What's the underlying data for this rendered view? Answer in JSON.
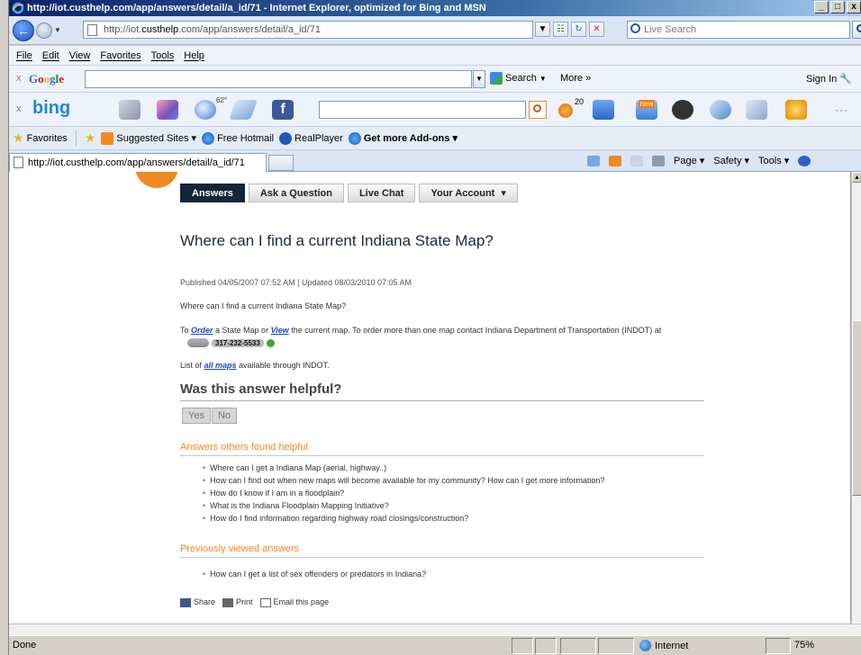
{
  "window": {
    "title": "http://iot.custhelp.com/app/answers/detail/a_id/71 - Internet Explorer, optimized for Bing and MSN",
    "buttons": [
      "_",
      "□",
      "x"
    ]
  },
  "address": {
    "url_prefix": "http://iot.",
    "url_host": "custhelp",
    "url_suffix": ".com/app/answers/detail/a_id/71",
    "live_search_placeholder": "Live Search"
  },
  "menu": [
    "File",
    "Edit",
    "View",
    "Favorites",
    "Tools",
    "Help"
  ],
  "google_toolbar": {
    "logo": "Google",
    "search_label": "Search",
    "more_label": "More »",
    "sign_in": "Sign In"
  },
  "bing_toolbar": {
    "logo": "bing",
    "temp": "62°",
    "badge_count": "20",
    "new_badge": "new",
    "more": "···"
  },
  "favorites": {
    "label": "Favorites",
    "items": [
      "Suggested Sites ▾",
      "Free Hotmail",
      "RealPlayer",
      "Get more Add-ons ▾"
    ]
  },
  "tab": {
    "title": "http://iot.custhelp.com/app/answers/detail/a_id/71"
  },
  "command_bar": [
    "Page ▾",
    "Safety ▾",
    "Tools ▾"
  ],
  "page": {
    "nav": [
      "Answers",
      "Ask a Question",
      "Live Chat",
      "Your Account"
    ],
    "nav_account_arrow": "▾",
    "question_title": "Where can I find a current Indiana State Map?",
    "published": "Published 04/05/2007 07:52 AM  |  Updated 08/03/2010 07:05 AM",
    "question_text": "Where can I find a current Indiana State Map?",
    "answer_p1_to": "To ",
    "answer_p1_order": "Order",
    "answer_p1_mid": " a State Map or ",
    "answer_p1_view": "View",
    "answer_p1_end": " the current map.   To order more than one map contact Indiana Department of Transportation (INDOT) at",
    "phone": "317-232-5533",
    "answer_p2_start": "List of ",
    "answer_p2_link": "all maps",
    "answer_p2_end": " available through INDOT.",
    "helpful_heading": "Was this answer helpful?",
    "yes": "Yes",
    "no": "No",
    "others_heading": "Answers others found helpful",
    "others": [
      "Where can I get a Indiana Map (aerial, highway..)",
      "How can I find out when new maps will become available for my community? How can I get more information?",
      "How do I know if I am in a floodplain?",
      "What is the Indiana Floodplain Mapping Initiative?",
      "How do I find information regarding highway road closings/construction?"
    ],
    "viewed_heading": "Previously viewed answers",
    "viewed": [
      "How can I get a list of sex offenders or predators in Indiana?"
    ],
    "share": "Share",
    "print": "Print",
    "email": "Email this page"
  },
  "status": {
    "text": "Done",
    "zone": "Internet",
    "zoom": "75%"
  }
}
